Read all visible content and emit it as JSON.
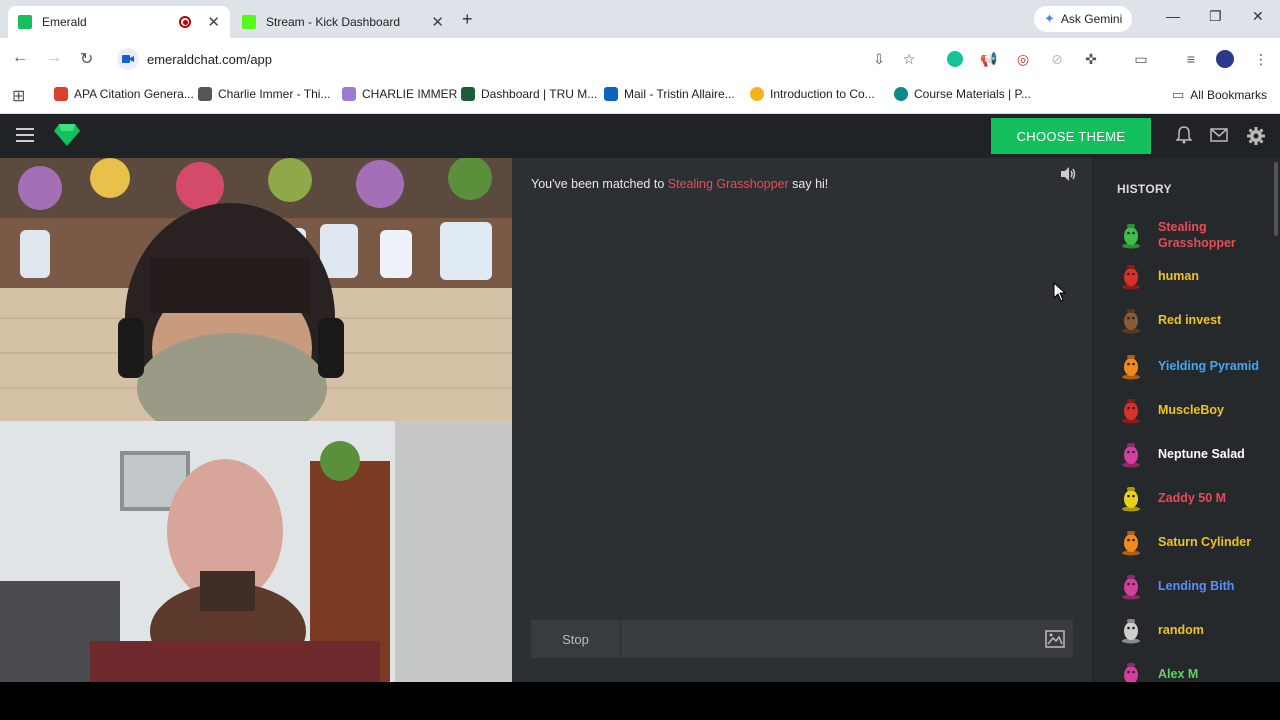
{
  "browser": {
    "tabs": [
      {
        "title": "Emerald",
        "active": true,
        "favicon_color": "#13c05c"
      },
      {
        "title": "Stream - Kick Dashboard",
        "active": false,
        "favicon_color": "#53fc18"
      }
    ],
    "ask_gemini": "Ask Gemini",
    "url": "emeraldchat.com/app",
    "bookmarks": [
      {
        "label": "APA Citation Genera...",
        "color": "#d9412a"
      },
      {
        "label": "Charlie Immer - Thi...",
        "color": "#555555"
      },
      {
        "label": "CHARLIE IMMER",
        "color": "#9b7bd1"
      },
      {
        "label": "Dashboard | TRU M...",
        "color": "#1e5b3a"
      },
      {
        "label": "Mail - Tristin Allaire...",
        "color": "#0a64c4"
      },
      {
        "label": "Introduction to Co...",
        "color": "#f2b21b"
      },
      {
        "label": "Course Materials | P...",
        "color": "#0a8a8a"
      }
    ],
    "all_bookmarks": "All Bookmarks"
  },
  "header": {
    "theme_button": "CHOOSE THEME",
    "accent": "#13c05c"
  },
  "chat": {
    "match_prefix": "You've been matched to",
    "match_name": "Stealing Grasshopper",
    "match_suffix": "say hi!",
    "stop_label": "Stop",
    "input_value": ""
  },
  "history": {
    "title": "HISTORY",
    "items": [
      {
        "name": "Stealing Grasshopper",
        "color": "#e84b56",
        "avatar": "green-blob"
      },
      {
        "name": "human",
        "color": "#f0c419",
        "avatar": "red-figure"
      },
      {
        "name": "Red invest",
        "color": "#f0c419",
        "avatar": "brown-acorn"
      },
      {
        "name": "Yielding Pyramid",
        "color": "#3fa9f5",
        "avatar": "orange-figure"
      },
      {
        "name": "MuscleBoy",
        "color": "#f0c419",
        "avatar": "red-figure"
      },
      {
        "name": "Neptune Salad",
        "color": "#ffffff",
        "avatar": "pink-figure"
      },
      {
        "name": "Zaddy 50 M",
        "color": "#e84b56",
        "avatar": "yellow-blob"
      },
      {
        "name": "Saturn Cylinder",
        "color": "#f0c419",
        "avatar": "orange-figure"
      },
      {
        "name": "Lending Bith",
        "color": "#5b8cff",
        "avatar": "pink-figure"
      },
      {
        "name": "random",
        "color": "#f0c419",
        "avatar": "gray-figure"
      },
      {
        "name": "Alex M",
        "color": "#5fd35f",
        "avatar": "pink-figure"
      }
    ]
  }
}
